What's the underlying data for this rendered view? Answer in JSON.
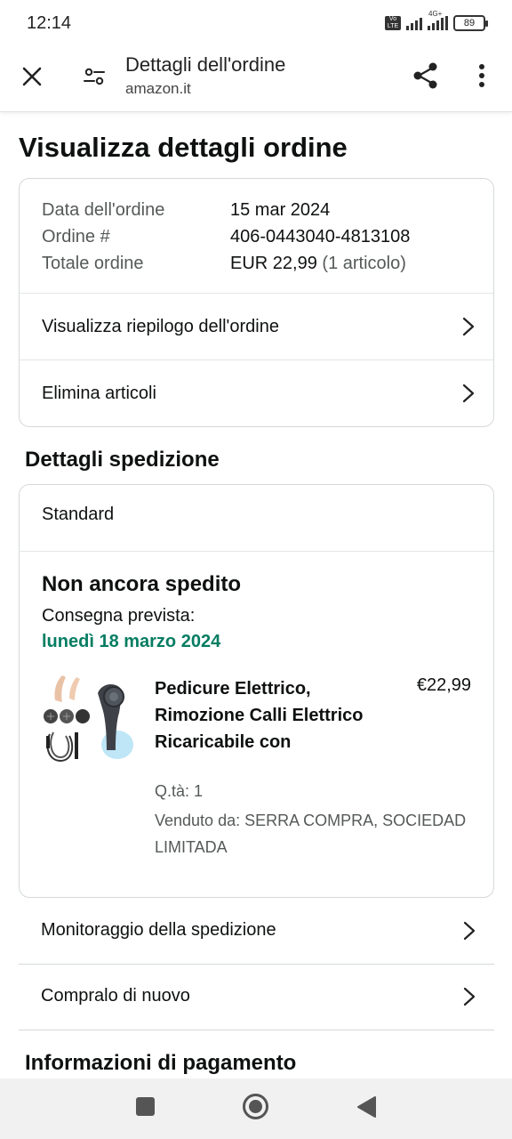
{
  "status_bar": {
    "time": "12:14",
    "network_label": "4G+",
    "battery": "89",
    "volte_label": "Vo LTE"
  },
  "toolbar": {
    "title": "Dettagli dell'ordine",
    "domain": "amazon.it",
    "icons": [
      "close-icon",
      "settings-sliders-icon",
      "share-icon",
      "more-vert-icon"
    ]
  },
  "page": {
    "title": "Visualizza dettagli ordine"
  },
  "order_summary": {
    "date_label": "Data dell'ordine",
    "date_value": "15 mar 2024",
    "number_label": "Ordine #",
    "number_value": "406-0443040-4813108",
    "total_label": "Totale ordine",
    "total_value": "EUR 22,99",
    "total_items": "(1 articolo)",
    "view_summary": "Visualizza riepilogo dell'ordine",
    "delete_items": "Elimina articoli"
  },
  "shipment": {
    "section_title": "Dettagli spedizione",
    "method": "Standard",
    "status": "Non ancora spedito",
    "eta_label": "Consegna prevista:",
    "eta_date": "lunedì 18 marzo 2024",
    "eta_color": "#067d62",
    "product": {
      "title": "Pedicure Elettrico, Rimozione Calli Elettrico Ricaricabile con",
      "price": "€22,99",
      "qty": "Q.tà: 1",
      "seller": "Venduto da: SERRA COMPRA, SOCIEDAD LIMITADA"
    }
  },
  "actions": {
    "tracking": "Monitoraggio della spedizione",
    "buy_again": "Compralo di nuovo"
  },
  "payment": {
    "section_title": "Informazioni di pagamento"
  },
  "nav_bar": {
    "icons": [
      "recents-icon",
      "home-icon",
      "back-icon"
    ]
  }
}
